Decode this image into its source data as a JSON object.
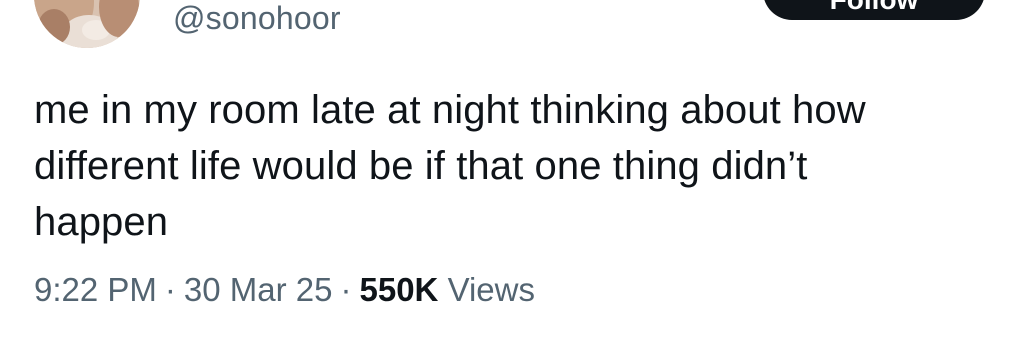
{
  "author": {
    "handle": "@sonohoor"
  },
  "header": {
    "follow_label": "Follow"
  },
  "tweet": {
    "text": "me in my room late at night thinking about how\ndifferent life would be if that one thing didn’t\nhappen"
  },
  "meta": {
    "time": "9:22 PM",
    "separator": "·",
    "date": "30 Mar 25",
    "views_count": "550K",
    "views_label": "Views"
  },
  "colors": {
    "text_primary": "#0f1419",
    "text_secondary": "#536471",
    "button_bg": "#0f1419",
    "background": "#ffffff"
  }
}
